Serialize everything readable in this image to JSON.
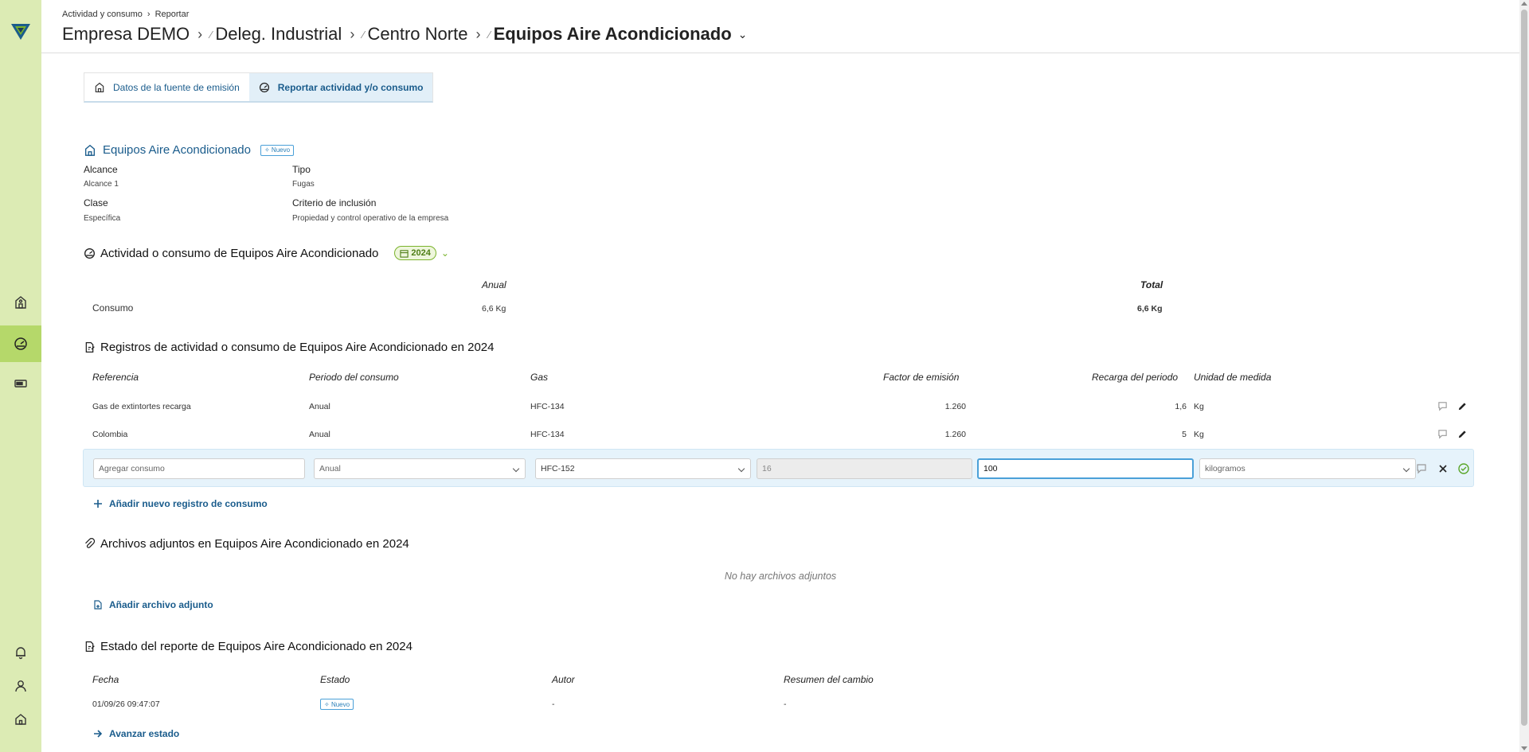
{
  "header": {
    "breadcrumb_small": [
      "Actividad y consumo",
      "Reportar"
    ],
    "breadcrumb": [
      "Empresa DEMO",
      "Deleg. Industrial",
      "Centro Norte",
      "Equipos Aire Acondicionado"
    ]
  },
  "tabs": [
    {
      "label": "Datos de la fuente de emisión"
    },
    {
      "label": "Reportar actividad y/o consumo"
    }
  ],
  "source": {
    "title": "Equipos Aire Acondicionado",
    "badge": "Nuevo",
    "alcance_label": "Alcance",
    "alcance_value": "Alcance 1",
    "tipo_label": "Tipo",
    "tipo_value": "Fugas",
    "clase_label": "Clase",
    "clase_value": "Específica",
    "criterio_label": "Criterio de inclusión",
    "criterio_value": "Propiedad y control operativo de la empresa"
  },
  "activity": {
    "title": "Actividad o consumo de Equipos Aire Acondicionado",
    "year": "2024",
    "col_anual": "Anual",
    "col_total": "Total",
    "row_label": "Consumo",
    "row_anual": "6,6 Kg",
    "row_total": "6,6 Kg"
  },
  "records": {
    "title": "Registros de actividad o consumo de Equipos Aire Acondicionado en 2024",
    "headers": [
      "Referencia",
      "Periodo del consumo",
      "Gas",
      "Factor de emisión",
      "Recarga del periodo",
      "Unidad de medida"
    ],
    "rows": [
      {
        "ref": "Gas de extintortes recarga",
        "periodo": "Anual",
        "gas": "HFC-134",
        "factor": "1.260",
        "recarga": "1,6",
        "unidad": "Kg"
      },
      {
        "ref": "Colombia",
        "periodo": "Anual",
        "gas": "HFC-134",
        "factor": "1.260",
        "recarga": "5",
        "unidad": "Kg"
      }
    ],
    "edit": {
      "ref_placeholder": "Agregar consumo",
      "periodo": "Anual",
      "gas": "HFC-152",
      "factor": "16",
      "recarga": "100",
      "unidad": "kilogramos"
    },
    "add_link": "Añadir nuevo registro de consumo"
  },
  "attachments": {
    "title": "Archivos adjuntos en Equipos Aire Acondicionado en 2024",
    "empty": "No hay archivos adjuntos",
    "add_link": "Añadir archivo adjunto"
  },
  "status": {
    "title": "Estado del reporte de Equipos Aire Acondicionado en 2024",
    "headers": [
      "Fecha",
      "Estado",
      "Autor",
      "Resumen del cambio"
    ],
    "row": {
      "fecha": "01/09/26 09:47:07",
      "estado": "Nuevo",
      "autor": "-",
      "resumen": "-"
    },
    "advance_link": "Avanzar estado"
  },
  "colors": {
    "accent": "#1a5c8c",
    "sidebar": "#dcebb4",
    "sidebar_active": "#b5d86a",
    "year_green": "#7ab32c"
  }
}
